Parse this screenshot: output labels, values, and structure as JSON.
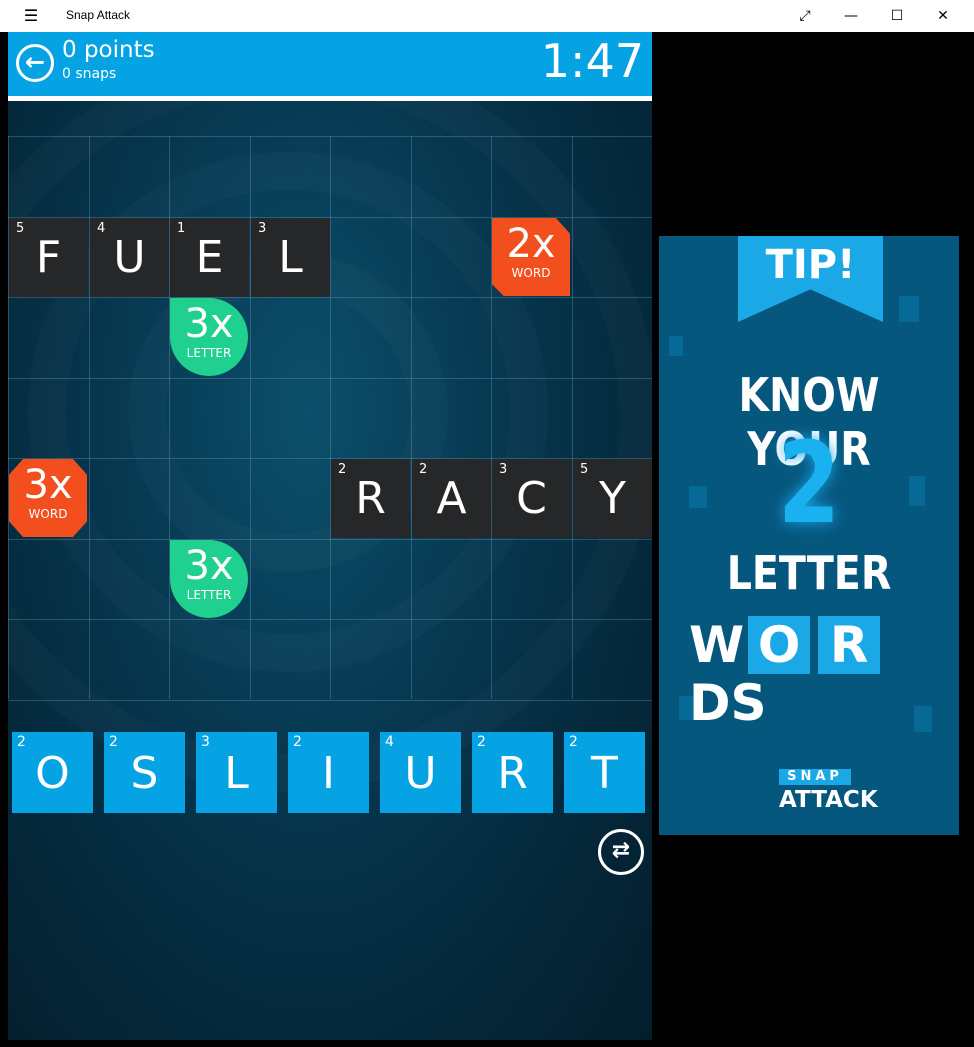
{
  "window": {
    "title": "Snap Attack",
    "controls": [
      "⤢",
      "—",
      "☐",
      "✕"
    ],
    "menu_icon": "☰"
  },
  "header": {
    "points": "0 points",
    "snaps": "0 snaps",
    "timer": "1:47",
    "back_icon": "back-arrow-icon"
  },
  "board": {
    "rows": 7,
    "cols": 8,
    "tiles": [
      {
        "row": 1,
        "col": 0,
        "letter": "F",
        "points": "5"
      },
      {
        "row": 1,
        "col": 1,
        "letter": "U",
        "points": "4"
      },
      {
        "row": 1,
        "col": 2,
        "letter": "E",
        "points": "1"
      },
      {
        "row": 1,
        "col": 3,
        "letter": "L",
        "points": "3"
      },
      {
        "row": 4,
        "col": 4,
        "letter": "R",
        "points": "2"
      },
      {
        "row": 4,
        "col": 5,
        "letter": "A",
        "points": "2"
      },
      {
        "row": 4,
        "col": 6,
        "letter": "C",
        "points": "3"
      },
      {
        "row": 4,
        "col": 7,
        "letter": "Y",
        "points": "5"
      }
    ],
    "bonuses": [
      {
        "row": 1,
        "col": 6,
        "mult": "2x",
        "kind": "WORD",
        "type": "word",
        "color": "#f24e1e"
      },
      {
        "row": 2,
        "col": 2,
        "mult": "3x",
        "kind": "LETTER",
        "type": "letter",
        "color": "#1fd08e"
      },
      {
        "row": 4,
        "col": 0,
        "mult": "3x",
        "kind": "WORD",
        "type": "word",
        "color": "#f24e1e"
      },
      {
        "row": 5,
        "col": 2,
        "mult": "3x",
        "kind": "LETTER",
        "type": "letter",
        "color": "#1fd08e"
      }
    ]
  },
  "rack": [
    {
      "letter": "O",
      "points": "2"
    },
    {
      "letter": "S",
      "points": "2"
    },
    {
      "letter": "L",
      "points": "3"
    },
    {
      "letter": "I",
      "points": "2"
    },
    {
      "letter": "U",
      "points": "4"
    },
    {
      "letter": "R",
      "points": "2"
    },
    {
      "letter": "T",
      "points": "2"
    }
  ],
  "shuffle_icon": "⇄",
  "ad": {
    "ribbon": "TIP!",
    "line1": "KNOW YOUR",
    "number": "2",
    "line3": "LETTER",
    "line4_parts": [
      {
        "text": "W",
        "highlight": false
      },
      {
        "text": "O",
        "highlight": true
      },
      {
        "text": "R",
        "highlight": true
      },
      {
        "text": "DS",
        "highlight": false
      }
    ],
    "logo_top": "SNAP",
    "logo_bottom": "ATTACK"
  },
  "colors": {
    "accent": "#05a3e4",
    "tile_dark": "#262729",
    "word_bonus": "#f24e1e",
    "letter_bonus": "#1fd08e"
  }
}
